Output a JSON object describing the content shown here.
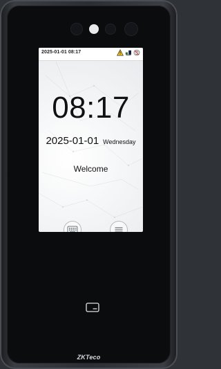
{
  "status_bar": {
    "datetime": "2025-01-01 08:17",
    "icons": [
      "warning-icon",
      "network-icon",
      "fingerprint-disabled-icon"
    ]
  },
  "main": {
    "time": "08:17",
    "date": "2025-01-01",
    "weekday": "Wednesday",
    "welcome": "Welcome"
  },
  "buttons": {
    "left_icon": "keyboard-icon",
    "right_icon": "menu-icon"
  },
  "device": {
    "card_icon": "card-icon",
    "brand": "ZKTeco"
  }
}
